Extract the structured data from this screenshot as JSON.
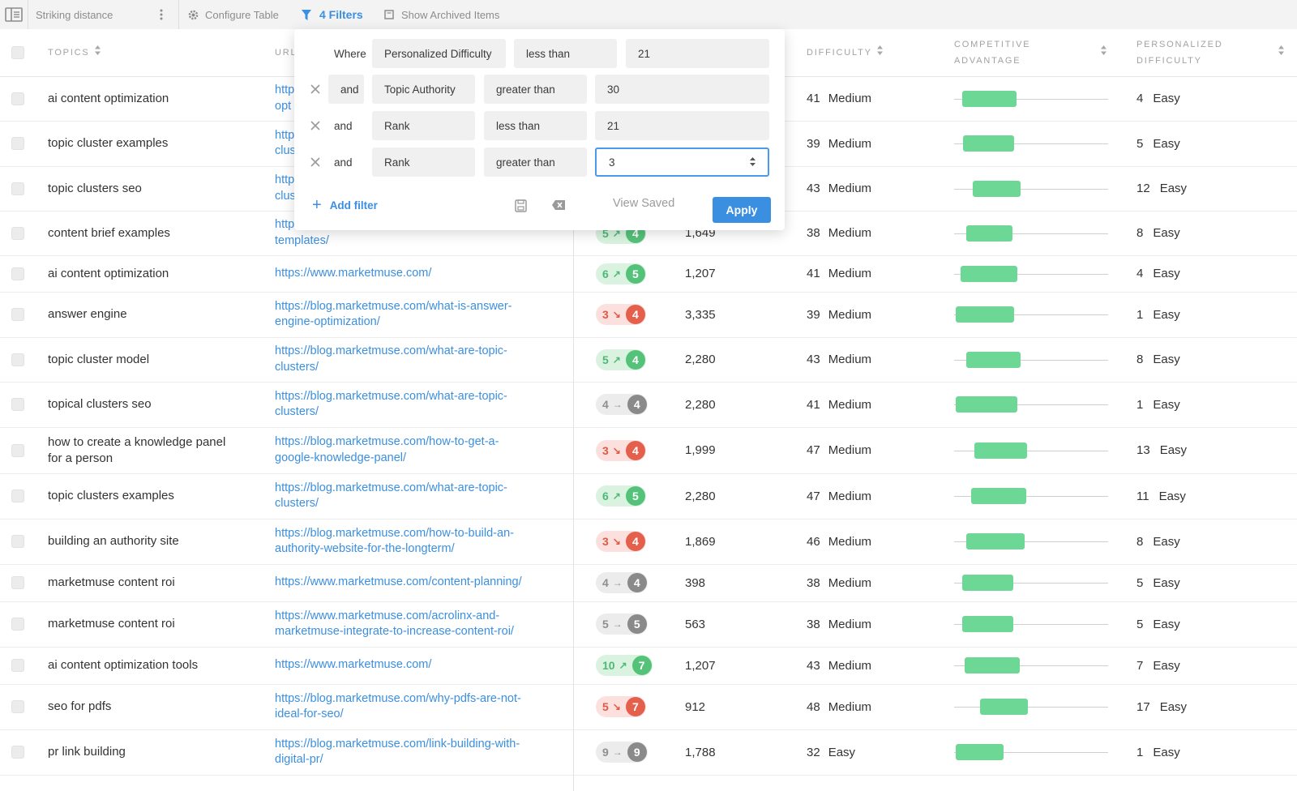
{
  "toolbar": {
    "view_name": "Striking distance",
    "configure_label": "Configure Table",
    "filters_label": "4 Filters",
    "archived_label": "Show Archived Items"
  },
  "columns": {
    "topics": "TOPICS",
    "url": "URL",
    "difficulty": "DIFFICULTY",
    "competitive_1": "COMPETITIVE",
    "competitive_2": "ADVANTAGE",
    "personalized_1": "PERSONALIZED",
    "personalized_2": "DIFFICULTY"
  },
  "filters": {
    "rows": [
      {
        "conj": "Where",
        "field": "Personalized Difficulty",
        "op": "less than",
        "value": "21"
      },
      {
        "conj": "and",
        "field": "Topic Authority",
        "op": "greater than",
        "value": "30"
      },
      {
        "conj": "and",
        "field": "Rank",
        "op": "less than",
        "value": "21"
      },
      {
        "conj": "and",
        "field": "Rank",
        "op": "greater than",
        "value": "3"
      }
    ],
    "add_label": "Add filter",
    "view_saved_label": "View Saved",
    "apply_label": "Apply"
  },
  "rows": [
    {
      "topic": "ai content optimization",
      "url1": "http",
      "url2": "opt",
      "rank_prev": "",
      "rank_curr": "",
      "trend": "",
      "volume": "",
      "diff": "41",
      "diff_label": "Medium",
      "comp": [
        0.05,
        0.4
      ],
      "pdiff": "4",
      "pdiff_label": "Easy"
    },
    {
      "topic": "topic cluster examples",
      "url1": "http",
      "url2": "clus",
      "rank_prev": "",
      "rank_curr": "",
      "trend": "",
      "volume": "",
      "diff": "39",
      "diff_label": "Medium",
      "comp": [
        0.06,
        0.39
      ],
      "pdiff": "5",
      "pdiff_label": "Easy"
    },
    {
      "topic": "topic clusters seo",
      "url1": "http",
      "url2": "clus",
      "rank_prev": "",
      "rank_curr": "",
      "trend": "",
      "volume": "",
      "diff": "43",
      "diff_label": "Medium",
      "comp": [
        0.12,
        0.43
      ],
      "pdiff": "12",
      "pdiff_label": "Easy"
    },
    {
      "topic": "content brief examples",
      "url1": "https://blog.marketmuse.com/content-brief-",
      "url2": "templates/",
      "rank_prev": "5",
      "rank_curr": "4",
      "trend": "up",
      "volume": "1,649",
      "diff": "38",
      "diff_label": "Medium",
      "comp": [
        0.08,
        0.38
      ],
      "pdiff": "8",
      "pdiff_label": "Easy"
    },
    {
      "topic": "ai content optimization",
      "url1": "https://www.marketmuse.com/",
      "url2": "",
      "rank_prev": "6",
      "rank_curr": "5",
      "trend": "up",
      "volume": "1,207",
      "diff": "41",
      "diff_label": "Medium",
      "comp": [
        0.04,
        0.41
      ],
      "pdiff": "4",
      "pdiff_label": "Easy"
    },
    {
      "topic": "answer engine",
      "url1": "https://blog.marketmuse.com/what-is-answer-",
      "url2": "engine-optimization/",
      "rank_prev": "3",
      "rank_curr": "4",
      "trend": "down",
      "volume": "3,335",
      "diff": "39",
      "diff_label": "Medium",
      "comp": [
        0.01,
        0.39
      ],
      "pdiff": "1",
      "pdiff_label": "Easy"
    },
    {
      "topic": "topic cluster model",
      "url1": "https://blog.marketmuse.com/what-are-topic-",
      "url2": "clusters/",
      "rank_prev": "5",
      "rank_curr": "4",
      "trend": "up",
      "volume": "2,280",
      "diff": "43",
      "diff_label": "Medium",
      "comp": [
        0.08,
        0.43
      ],
      "pdiff": "8",
      "pdiff_label": "Easy"
    },
    {
      "topic": "topical clusters seo",
      "url1": "https://blog.marketmuse.com/what-are-topic-",
      "url2": "clusters/",
      "rank_prev": "4",
      "rank_curr": "4",
      "trend": "flat",
      "volume": "2,280",
      "diff": "41",
      "diff_label": "Medium",
      "comp": [
        0.01,
        0.41
      ],
      "pdiff": "1",
      "pdiff_label": "Easy"
    },
    {
      "topic": "how to create a knowledge panel",
      "topic2": "for a person",
      "url1": "https://blog.marketmuse.com/how-to-get-a-",
      "url2": "google-knowledge-panel/",
      "rank_prev": "3",
      "rank_curr": "4",
      "trend": "down",
      "volume": "1,999",
      "diff": "47",
      "diff_label": "Medium",
      "comp": [
        0.13,
        0.47
      ],
      "pdiff": "13",
      "pdiff_label": "Easy"
    },
    {
      "topic": "topic clusters examples",
      "url1": "https://blog.marketmuse.com/what-are-topic-",
      "url2": "clusters/",
      "rank_prev": "6",
      "rank_curr": "5",
      "trend": "up",
      "volume": "2,280",
      "diff": "47",
      "diff_label": "Medium",
      "comp": [
        0.11,
        0.47
      ],
      "pdiff": "11",
      "pdiff_label": "Easy"
    },
    {
      "topic": "building an authority site",
      "url1": "https://blog.marketmuse.com/how-to-build-an-",
      "url2": "authority-website-for-the-longterm/",
      "rank_prev": "3",
      "rank_curr": "4",
      "trend": "down",
      "volume": "1,869",
      "diff": "46",
      "diff_label": "Medium",
      "comp": [
        0.08,
        0.46
      ],
      "pdiff": "8",
      "pdiff_label": "Easy"
    },
    {
      "topic": "marketmuse content roi",
      "url1": "https://www.marketmuse.com/content-planning/",
      "url2": "",
      "rank_prev": "4",
      "rank_curr": "4",
      "trend": "flat",
      "volume": "398",
      "diff": "38",
      "diff_label": "Medium",
      "comp": [
        0.05,
        0.38
      ],
      "pdiff": "5",
      "pdiff_label": "Easy"
    },
    {
      "topic": "marketmuse content roi",
      "url1": "https://www.marketmuse.com/acrolinx-and-",
      "url2": "marketmuse-integrate-to-increase-content-roi/",
      "rank_prev": "5",
      "rank_curr": "5",
      "trend": "flat",
      "volume": "563",
      "diff": "38",
      "diff_label": "Medium",
      "comp": [
        0.05,
        0.38
      ],
      "pdiff": "5",
      "pdiff_label": "Easy"
    },
    {
      "topic": "ai content optimization tools",
      "url1": "https://www.marketmuse.com/",
      "url2": "",
      "rank_prev": "10",
      "rank_curr": "7",
      "trend": "up",
      "volume": "1,207",
      "diff": "43",
      "diff_label": "Medium",
      "comp": [
        0.07,
        0.43
      ],
      "pdiff": "7",
      "pdiff_label": "Easy"
    },
    {
      "topic": "seo for pdfs",
      "url1": "https://blog.marketmuse.com/why-pdfs-are-not-",
      "url2": "ideal-for-seo/",
      "rank_prev": "5",
      "rank_curr": "7",
      "trend": "down",
      "volume": "912",
      "diff": "48",
      "diff_label": "Medium",
      "comp": [
        0.17,
        0.48
      ],
      "pdiff": "17",
      "pdiff_label": "Easy"
    },
    {
      "topic": "pr link building",
      "url1": "https://blog.marketmuse.com/link-building-with-",
      "url2": "digital-pr/",
      "rank_prev": "9",
      "rank_curr": "9",
      "trend": "flat",
      "volume": "1,788",
      "diff": "32",
      "diff_label": "Easy",
      "comp": [
        0.01,
        0.32
      ],
      "pdiff": "1",
      "pdiff_label": "Easy"
    }
  ]
}
